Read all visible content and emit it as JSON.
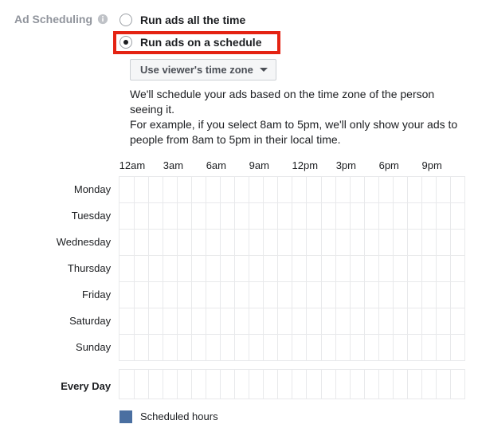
{
  "section_label": "Ad Scheduling",
  "radios": {
    "all_time": "Run ads all the time",
    "on_schedule": "Run ads on a schedule"
  },
  "timezone_dropdown": {
    "selected": "Use viewer's time zone"
  },
  "explain": {
    "line1": "We'll schedule your ads based on the time zone of the person seeing it.",
    "line2": "For example, if you select 8am to 5pm, we'll only show your ads to people from 8am to 5pm in their local time."
  },
  "hours": [
    "12am",
    "3am",
    "6am",
    "9am",
    "12pm",
    "3pm",
    "6pm",
    "9pm"
  ],
  "days": [
    "Monday",
    "Tuesday",
    "Wednesday",
    "Thursday",
    "Friday",
    "Saturday",
    "Sunday"
  ],
  "every_day_label": "Every Day",
  "legend": {
    "scheduled": "Scheduled hours"
  },
  "colors": {
    "highlight": "#e42313",
    "swatch": "#4a6fa1"
  }
}
